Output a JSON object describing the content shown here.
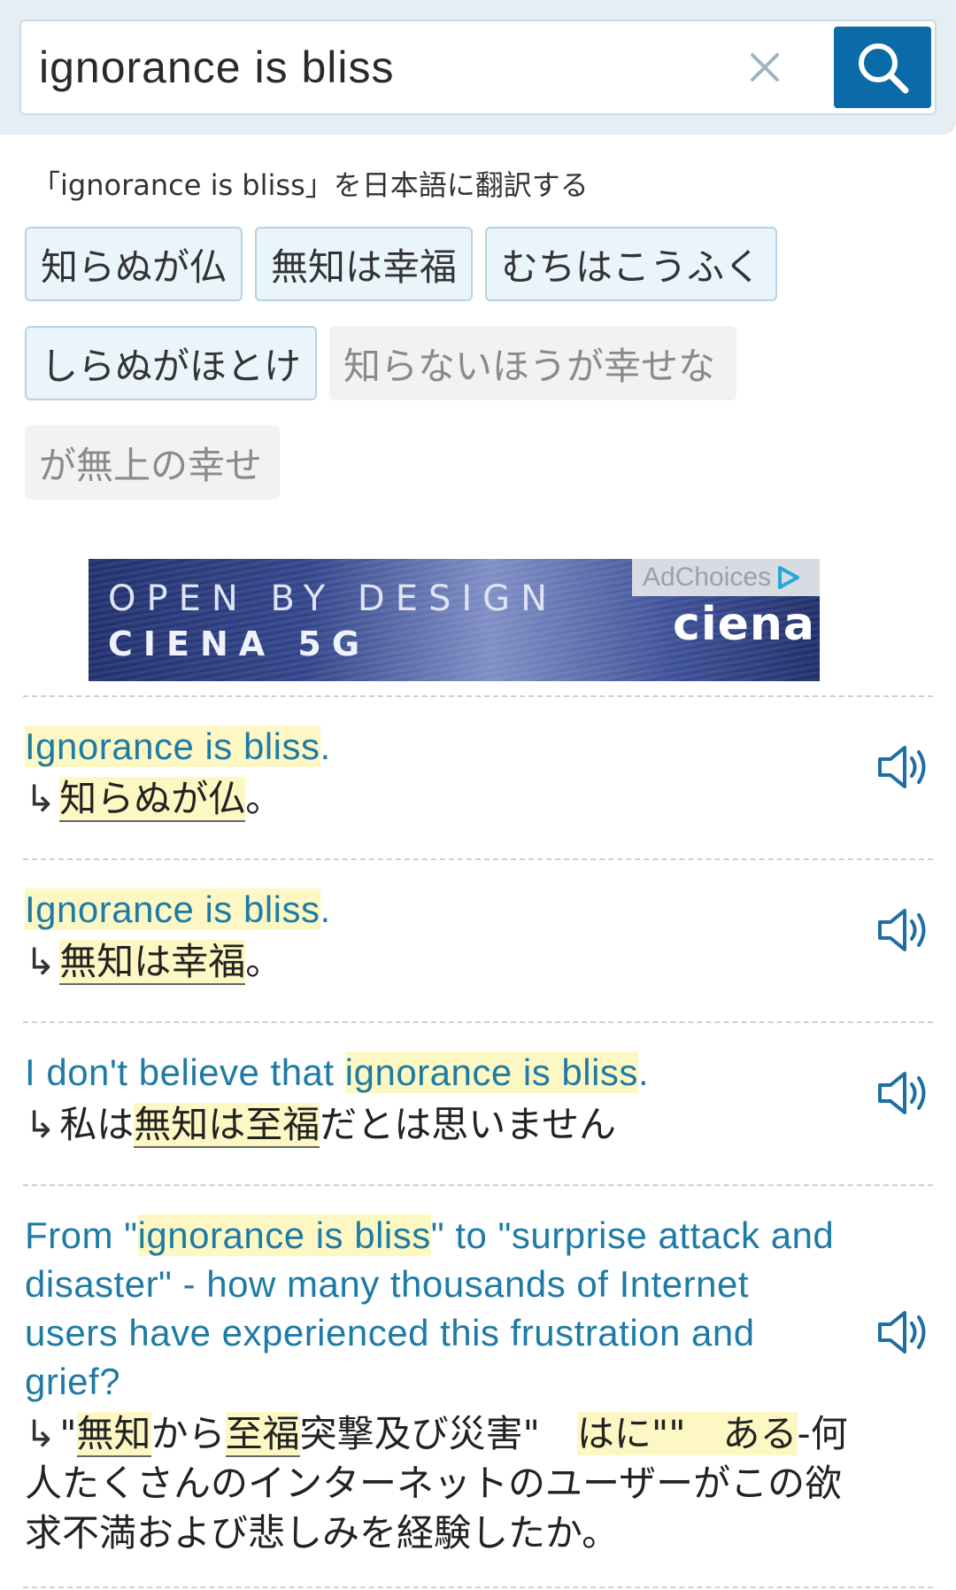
{
  "search": {
    "value": "ignorance is bliss",
    "clear_icon": "close-icon",
    "search_icon": "search-icon",
    "accent_color": "#0b6aa8"
  },
  "translate_heading": "「ignorance is bliss」を日本語に翻訳する",
  "suggestions": {
    "primary": [
      "知らぬが仏",
      "無知は幸福",
      "むちはこうふく",
      "しらぬがほとけ"
    ],
    "secondary": [
      "知らないほうが幸せな",
      "が無上の幸せ"
    ]
  },
  "ad": {
    "line1": "OPEN BY DESIGN",
    "line2": "CIENA 5G",
    "choices": "AdChoices",
    "brand": "ciena"
  },
  "entries": [
    {
      "en_parts": [
        "",
        "Ignorance is bliss",
        "."
      ],
      "ja_parts": [
        "",
        "知らぬが仏",
        "。"
      ]
    },
    {
      "en_parts": [
        "",
        "Ignorance is bliss",
        "."
      ],
      "ja_parts": [
        "",
        "無知は幸福",
        "。"
      ]
    },
    {
      "en_parts": [
        "I don't believe that ",
        "ignorance is bliss",
        "."
      ],
      "ja_parts": [
        "私は",
        "無知は至福",
        "だとは思いません"
      ]
    },
    {
      "en_parts": [
        "From \"",
        "ignorance is bliss",
        "\" to \"surprise attack and disaster\" - how many thousands of Internet users have experienced this frustration and grief?"
      ],
      "ja_seg": [
        "\"",
        "無知",
        "から",
        "至福",
        "突撃及び災害\"　",
        "はに\"\"　ある",
        "-何人たくさんのインターネットのユーザーがこの欲求不満および悲しみを経験したか。"
      ]
    }
  ],
  "arrow_glyph": "↳",
  "speaker_icon": "speaker-icon"
}
